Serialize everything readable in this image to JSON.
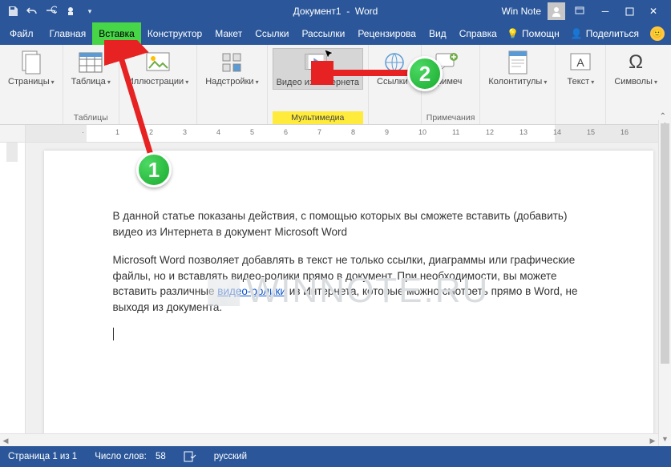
{
  "title": {
    "doc": "Документ1",
    "app": "Word",
    "brand": "Win Note"
  },
  "menu": {
    "file": "Файл",
    "tabs": [
      "Главная",
      "Вставка",
      "Конструктор",
      "Макет",
      "Ссылки",
      "Рассылки",
      "Рецензирова",
      "Вид",
      "Справка"
    ],
    "active_index": 1,
    "help": "Помощн",
    "share": "Поделиться"
  },
  "ribbon": {
    "groups": [
      {
        "title": "",
        "buttons": [
          {
            "label": "Страницы",
            "icon": "pages",
            "caret": true
          }
        ]
      },
      {
        "title": "Таблицы",
        "buttons": [
          {
            "label": "Таблица",
            "icon": "table",
            "caret": true
          }
        ]
      },
      {
        "title": "",
        "buttons": [
          {
            "label": "Иллюстрации",
            "icon": "picture",
            "caret": true
          }
        ]
      },
      {
        "title": "",
        "buttons": [
          {
            "label": "Надстройки",
            "icon": "addins",
            "caret": true
          }
        ]
      },
      {
        "title": "Мультимедиа",
        "hl": true,
        "buttons": [
          {
            "label": "Видео из\nИнтернета",
            "icon": "video",
            "sel": true
          }
        ]
      },
      {
        "title": "",
        "buttons": [
          {
            "label": "Ссылки",
            "icon": "link",
            "caret": true
          }
        ]
      },
      {
        "title": "Примечания",
        "buttons": [
          {
            "label": "Примеч",
            "icon": "comment"
          }
        ]
      },
      {
        "title": "",
        "buttons": [
          {
            "label": "Колонтитулы",
            "icon": "header",
            "caret": true
          }
        ]
      },
      {
        "title": "",
        "buttons": [
          {
            "label": "Текст",
            "icon": "textbox",
            "caret": true
          }
        ]
      },
      {
        "title": "",
        "buttons": [
          {
            "label": "Символы",
            "icon": "omega",
            "caret": true
          }
        ]
      }
    ]
  },
  "document": {
    "p1": "В данной статье показаны действия, с помощью которых вы сможете вставить (добавить) видео из Интернета в документ Microsoft Word",
    "p2a": "Microsoft Word позволяет добавлять в текст не только ссылки, диаграммы или графические файлы, но и вставлять видео-ролики прямо в документ. При необходимости, вы можете вставить различные ",
    "p2_link": "видео-ролики",
    "p2b": " из Интернета, которые можно смотреть прямо в Word, не выходя из документа."
  },
  "watermark": "WINNOTE.RU",
  "status": {
    "page": "Страница 1 из 1",
    "words_label": "Число слов:",
    "words": "58",
    "lang": "русский"
  },
  "annotations": {
    "b1": "1",
    "b2": "2"
  }
}
